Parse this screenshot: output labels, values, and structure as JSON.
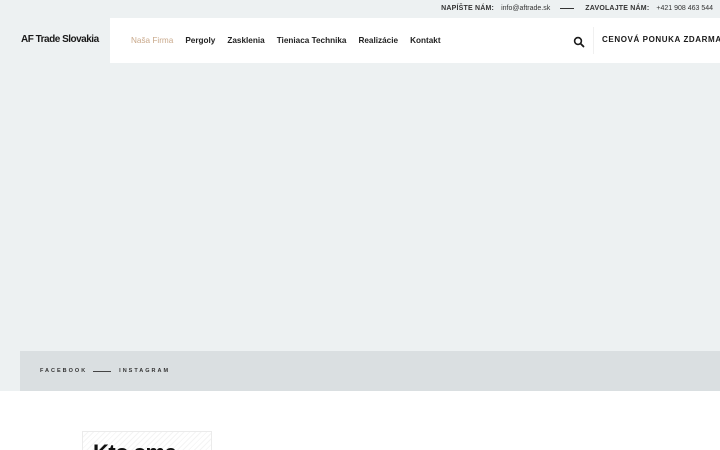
{
  "topbar": {
    "write_label": "NAPÍŠTE NÁM:",
    "email": "info@aftrade.sk",
    "call_label": "ZAVOLAJTE NÁM:",
    "phone": "+421 908 463 544"
  },
  "logo": {
    "text": "AF Trade Slovakia"
  },
  "nav": {
    "items": [
      {
        "label": "Naša Firma",
        "active": true
      },
      {
        "label": "Pergoly"
      },
      {
        "label": "Zasklenia"
      },
      {
        "label": "Tieniaca Technika"
      },
      {
        "label": "Realizácie"
      },
      {
        "label": "Kontakt"
      }
    ],
    "search_icon": "search-icon",
    "cta_label": "CENOVÁ PONUKA ZDARMA"
  },
  "social": {
    "facebook": "FACEBOOK",
    "instagram": "INSTAGRAM"
  },
  "content": {
    "heading": "Kto sme"
  },
  "colors": {
    "accent": "#c9a88a",
    "hero_bg": "#edf1f2",
    "strip_bg": "#dadfe1"
  }
}
